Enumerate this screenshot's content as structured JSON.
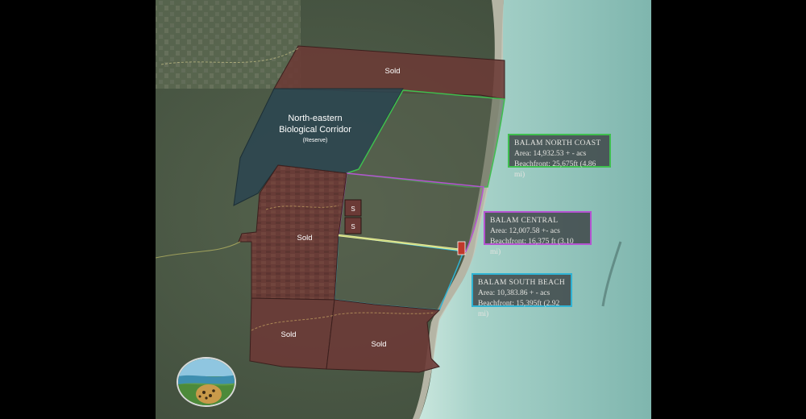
{
  "labels": {
    "sold_top": "Sold",
    "corridor_line1": "North-eastern",
    "corridor_line2": "Biological Corridor",
    "corridor_line3": "(Reserve)",
    "sold_middle": "Sold",
    "s_upper": "S",
    "s_lower": "S",
    "sold_bottom_left": "Sold",
    "sold_bottom_right": "Sold"
  },
  "info_boxes": {
    "north": {
      "title": "BALAM NORTH COAST",
      "area": "Area: 14,932.53 + - acs",
      "beachfront": "Beachfront: 25,675ft (4.86 mi)",
      "border_color": "#3fbf4f"
    },
    "central": {
      "title": "BALAM CENTRAL",
      "area": "Area: 12,007.58 +- acs",
      "beachfront": "Beachfront: 16,375 ft (3.10 mi)",
      "border_color": "#b553d2"
    },
    "south": {
      "title": "BALAM SOUTH BEACH",
      "area": "Area: 10,383.86 + - acs",
      "beachfront": "Beachfront: 15,395ft (2.92 mi)",
      "border_color": "#2fb3d4"
    }
  },
  "colors": {
    "sold_parcel": "#6b3a36",
    "reserve_parcel": "#2c4650",
    "land": "#4a5a45",
    "sea": "#9ec9c0"
  },
  "icons": [
    "jaguar-logo-icon"
  ]
}
